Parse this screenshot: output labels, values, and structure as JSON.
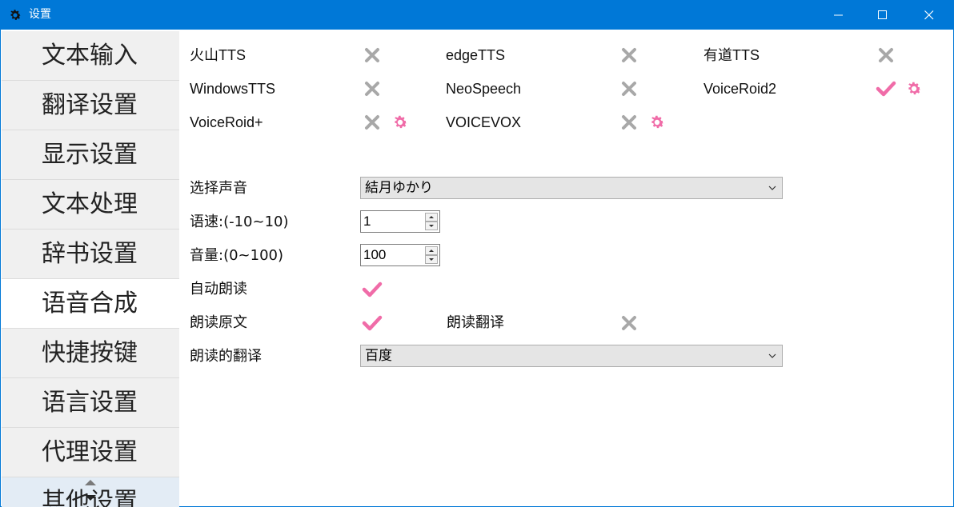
{
  "window": {
    "title": "设置",
    "icons": [
      "gear-icon",
      "minimize-icon",
      "maximize-icon",
      "close-icon"
    ]
  },
  "sidebar": {
    "items": [
      {
        "label": "文本输入",
        "active": false
      },
      {
        "label": "翻译设置",
        "active": false
      },
      {
        "label": "显示设置",
        "active": false
      },
      {
        "label": "文本处理",
        "active": false
      },
      {
        "label": "辞书设置",
        "active": false
      },
      {
        "label": "语音合成",
        "active": true
      },
      {
        "label": "快捷按键",
        "active": false
      },
      {
        "label": "语言设置",
        "active": false
      },
      {
        "label": "代理设置",
        "active": false
      },
      {
        "label": "其他设置",
        "active": false
      }
    ]
  },
  "engines": [
    {
      "name": "火山TTS",
      "enabled": false,
      "settings": false
    },
    {
      "name": "edgeTTS",
      "enabled": false,
      "settings": false
    },
    {
      "name": "有道TTS",
      "enabled": false,
      "settings": false
    },
    {
      "name": "WindowsTTS",
      "enabled": false,
      "settings": false
    },
    {
      "name": "NeoSpeech",
      "enabled": false,
      "settings": false
    },
    {
      "name": "VoiceRoid2",
      "enabled": true,
      "settings": true
    },
    {
      "name": "VoiceRoid+",
      "enabled": false,
      "settings": true
    },
    {
      "name": "VOICEVOX",
      "enabled": false,
      "settings": true
    }
  ],
  "form": {
    "voice": {
      "label": "选择声音",
      "value": "結月ゆかり"
    },
    "speed": {
      "label": "语速:(-10~10)",
      "value": "1"
    },
    "volume": {
      "label": "音量:(0~100)",
      "value": "100"
    },
    "auto_read": {
      "label": "自动朗读",
      "checked": true
    },
    "read_original": {
      "label": "朗读原文",
      "checked": true
    },
    "read_translation": {
      "label": "朗读翻译",
      "checked": false
    },
    "translation_source": {
      "label": "朗读的翻译",
      "value": "百度"
    }
  },
  "colors": {
    "titlebar": "#0078d7",
    "check": "#f06ca8",
    "cross": "#a8a8a8",
    "gear": "#f06ca8",
    "sidebar_bg": "#f0f0f0"
  }
}
